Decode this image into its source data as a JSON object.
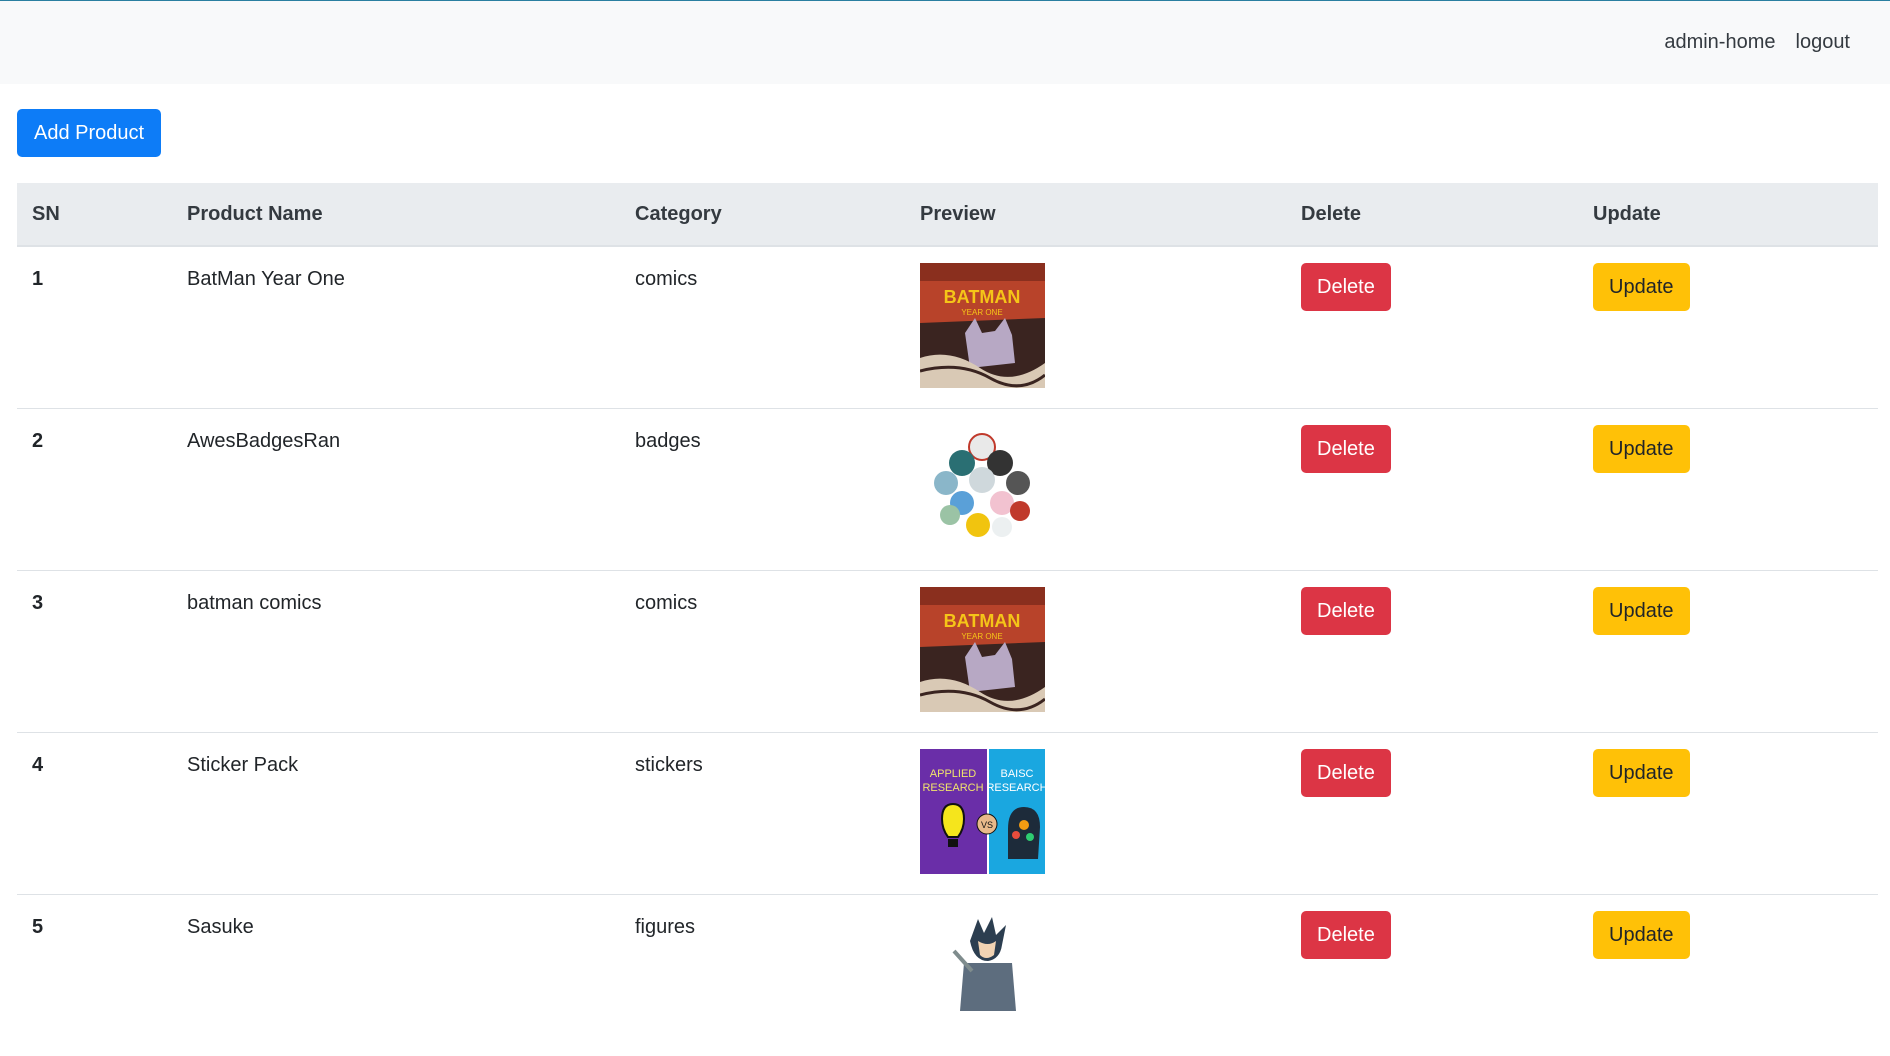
{
  "nav": {
    "links": [
      "admin-home",
      "logout"
    ]
  },
  "toolbar": {
    "add_label": "Add Product"
  },
  "table": {
    "headers": [
      "SN",
      "Product Name",
      "Category",
      "Preview",
      "Delete",
      "Update"
    ],
    "rows": [
      {
        "sn": "1",
        "name": "BatMan Year One",
        "category": "comics",
        "preview": "batman-cover",
        "delete": "Delete",
        "update": "Update"
      },
      {
        "sn": "2",
        "name": "AwesBadgesRan",
        "category": "badges",
        "preview": "badges",
        "delete": "Delete",
        "update": "Update"
      },
      {
        "sn": "3",
        "name": "batman comics",
        "category": "comics",
        "preview": "batman-cover",
        "delete": "Delete",
        "update": "Update"
      },
      {
        "sn": "4",
        "name": "Sticker Pack",
        "category": "stickers",
        "preview": "research-sticker",
        "delete": "Delete",
        "update": "Update"
      },
      {
        "sn": "5",
        "name": "Sasuke",
        "category": "figures",
        "preview": "sasuke-figure",
        "delete": "Delete",
        "update": "Update"
      }
    ]
  },
  "preview_text": {
    "batman_title": "BATMAN",
    "batman_sub": "YEAR ONE",
    "sticker_left": [
      "APPLIED",
      "RESEARCH"
    ],
    "sticker_right": [
      "BAISC",
      "RESEARCH"
    ],
    "sticker_vs": "VS"
  },
  "colors": {
    "primary": "#0d7cf7",
    "danger": "#dc3545",
    "warning": "#ffc107",
    "navbar_bg": "#f8f9fa",
    "thead_bg": "#e9ecef"
  }
}
